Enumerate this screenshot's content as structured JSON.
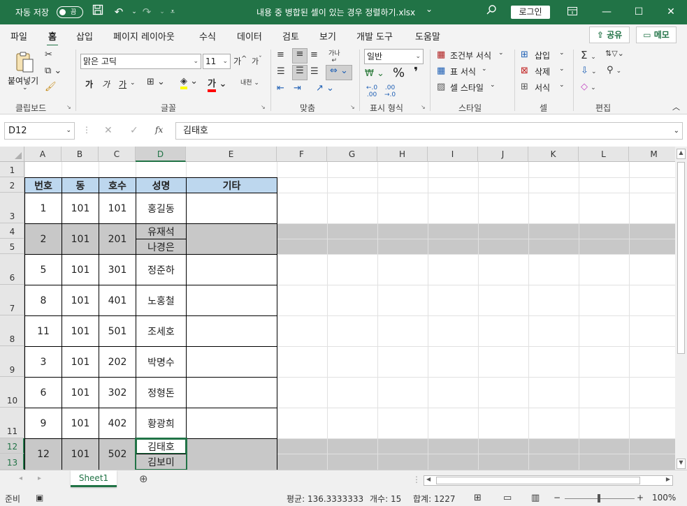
{
  "titlebar": {
    "autosave_label": "자동 저장",
    "autosave_state": "끔",
    "doc_title": "내용 중 병합된 셀이 있는 경우 정렬하기.xlsx",
    "title_chevron": "⌄",
    "login_label": "로그인",
    "icons": [
      "save-icon",
      "undo-icon",
      "redo-icon",
      "customize-icon",
      "search-icon",
      "ribbon-display-icon",
      "minimize-icon",
      "maximize-icon",
      "close-icon"
    ]
  },
  "tabs": [
    "파일",
    "홈",
    "삽입",
    "페이지 레이아웃",
    "수식",
    "데이터",
    "검토",
    "보기",
    "개발 도구",
    "도움말"
  ],
  "active_tab": "홈",
  "share_label": "공유",
  "memo_label": "메모",
  "ribbon": {
    "clipboard": {
      "label": "클립보드",
      "paste": "붙여넣기"
    },
    "font": {
      "label": "글꼴",
      "font_name": "맑은 고딕",
      "font_size": "11",
      "bold": "가",
      "italic": "가",
      "underline": "가"
    },
    "alignment": {
      "label": "맞춤"
    },
    "number": {
      "label": "표시 형식",
      "format": "일반",
      "percent": "%",
      "comma": "❜"
    },
    "styles": {
      "label": "스타일",
      "conditional": "조건부 서식",
      "table": "표 서식",
      "cell_styles": "셀 스타일"
    },
    "cells": {
      "label": "셀",
      "insert": "삽입",
      "delete": "삭제",
      "format": "서식"
    },
    "editing": {
      "label": "편집"
    }
  },
  "formula": {
    "name_box": "D12",
    "fx": "fx",
    "value": "김태호"
  },
  "columns": [
    "A",
    "B",
    "C",
    "D",
    "E",
    "F",
    "G",
    "H",
    "I",
    "J",
    "K",
    "L",
    "M"
  ],
  "rows": [
    "1",
    "2",
    "3",
    "4",
    "5",
    "6",
    "7",
    "8",
    "9",
    "10",
    "11",
    "12",
    "13"
  ],
  "table": {
    "headers": [
      "번호",
      "동",
      "호수",
      "성명",
      "기타"
    ],
    "records": [
      {
        "no": "1",
        "dong": "101",
        "ho": "101",
        "names": [
          "홍길동"
        ]
      },
      {
        "no": "2",
        "dong": "101",
        "ho": "201",
        "names": [
          "유재석",
          "나경은"
        ]
      },
      {
        "no": "5",
        "dong": "101",
        "ho": "301",
        "names": [
          "정준하"
        ]
      },
      {
        "no": "8",
        "dong": "101",
        "ho": "401",
        "names": [
          "노홍철"
        ]
      },
      {
        "no": "11",
        "dong": "101",
        "ho": "501",
        "names": [
          "조세호"
        ]
      },
      {
        "no": "3",
        "dong": "101",
        "ho": "202",
        "names": [
          "박명수"
        ]
      },
      {
        "no": "6",
        "dong": "101",
        "ho": "302",
        "names": [
          "정형돈"
        ]
      },
      {
        "no": "9",
        "dong": "101",
        "ho": "402",
        "names": [
          "황광희"
        ]
      },
      {
        "no": "12",
        "dong": "101",
        "ho": "502",
        "names": [
          "김태호",
          "김보미"
        ]
      }
    ]
  },
  "sheet_tab": "Sheet1",
  "status": {
    "mode": "준비",
    "average": "평균: 136.3333333",
    "count": "개수: 15",
    "sum": "합계: 1227",
    "zoom": "100%"
  },
  "colors": {
    "accent": "#217346",
    "header_fill": "#bdd7ee",
    "merged_fill": "#c8c8c8"
  }
}
